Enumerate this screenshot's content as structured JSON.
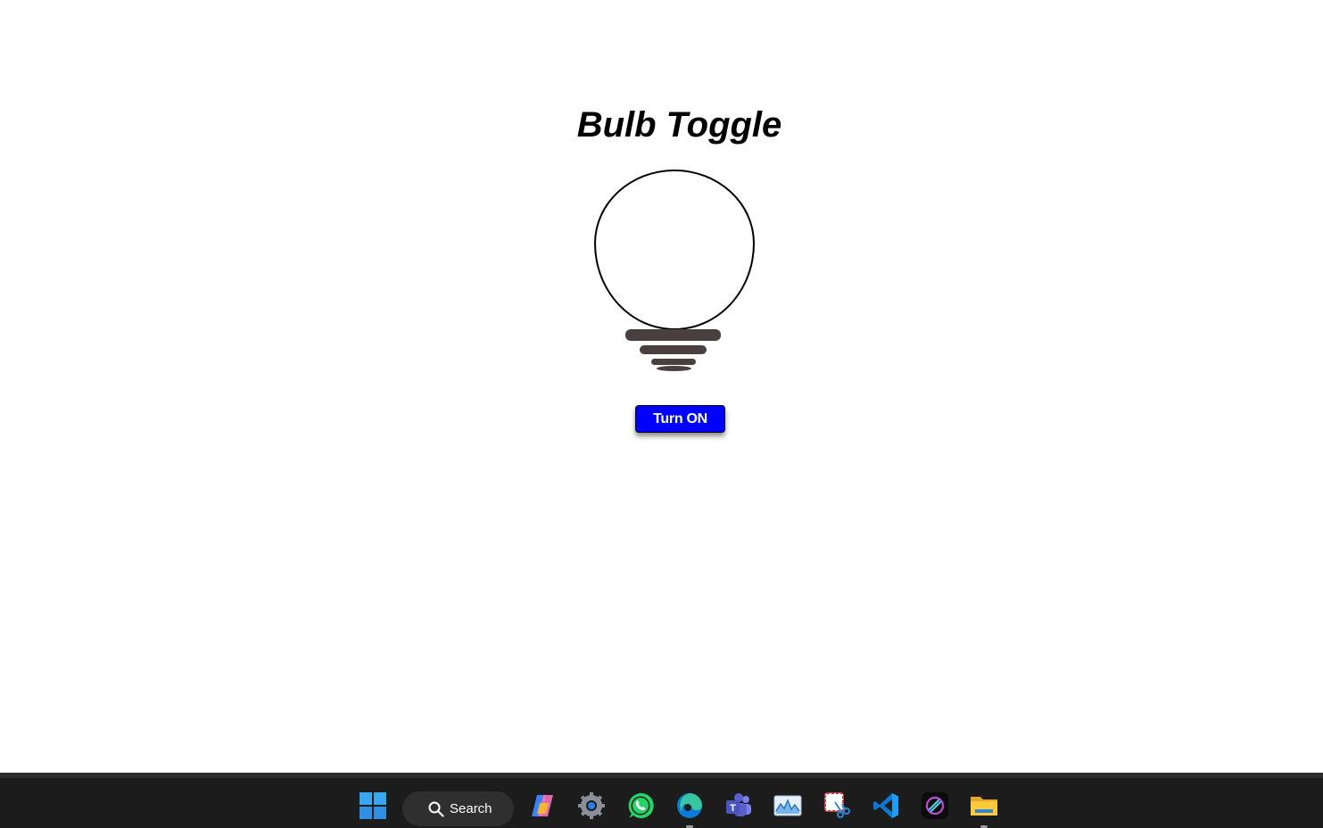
{
  "app": {
    "title": "Bulb Toggle",
    "toggle_button_label": "Turn ON",
    "bulb_state": "off",
    "button_color": "#0000ff"
  },
  "taskbar": {
    "search_label": "Search",
    "icons": [
      "windows-start-icon",
      "search-icon",
      "copilot-icon",
      "settings-icon",
      "whatsapp-icon",
      "edge-icon",
      "teams-icon",
      "performance-monitor-icon",
      "snipping-tool-icon",
      "vscode-icon",
      "linear-app-icon",
      "file-explorer-icon"
    ]
  }
}
